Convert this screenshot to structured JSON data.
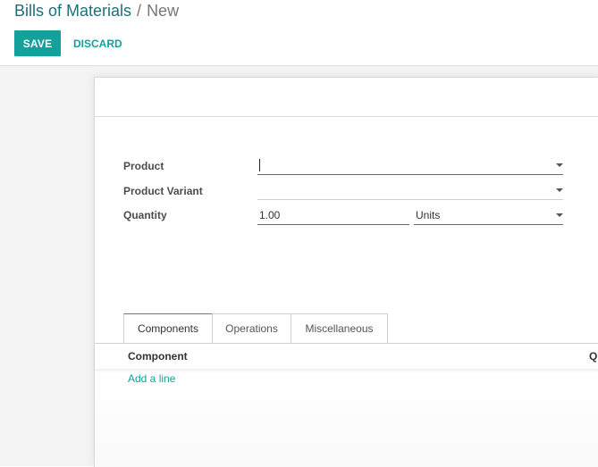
{
  "breadcrumb": {
    "parent": "Bills of Materials",
    "separator": "/",
    "current": "New"
  },
  "toolbar": {
    "save_label": "SAVE",
    "discard_label": "DISCARD"
  },
  "form": {
    "product": {
      "label": "Product",
      "value": ""
    },
    "product_variant": {
      "label": "Product Variant",
      "value": ""
    },
    "quantity": {
      "label": "Quantity",
      "value": "1.00",
      "uom": "Units"
    }
  },
  "tabs": [
    {
      "label": "Components",
      "active": true
    },
    {
      "label": "Operations",
      "active": false
    },
    {
      "label": "Miscellaneous",
      "active": false
    }
  ],
  "components_list": {
    "columns": [
      "Component",
      "Q"
    ],
    "add_line_label": "Add a line"
  },
  "colors": {
    "accent": "#14a09b",
    "breadcrumb_link": "#1f6f7a"
  }
}
